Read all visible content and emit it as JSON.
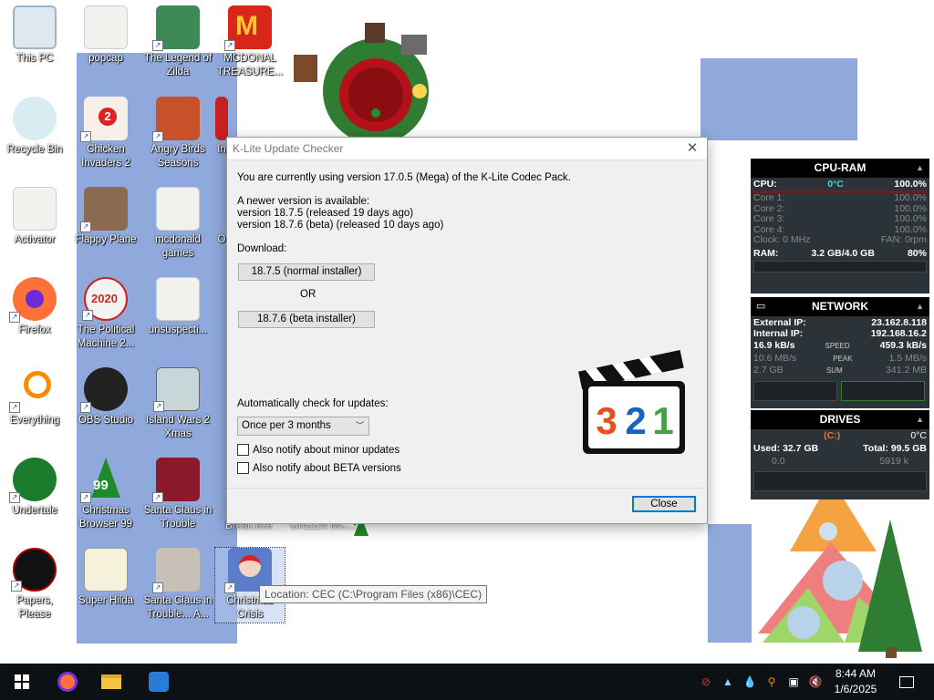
{
  "desktop": {
    "icons": [
      {
        "label": "This PC"
      },
      {
        "label": "popcap"
      },
      {
        "label": "The Legend of Zilda"
      },
      {
        "label": "MCDONAL TREASURE..."
      },
      {
        "label": "Recycle Bin"
      },
      {
        "label": "Chicken Invaders 2"
      },
      {
        "label": "Angry Birds Seasons"
      },
      {
        "label": "In"
      },
      {
        "label": "Activator"
      },
      {
        "label": "Flappy Plane"
      },
      {
        "label": "mcdonald games"
      },
      {
        "label": "O"
      },
      {
        "label": "Firefox"
      },
      {
        "label": "The Political Machine 2..."
      },
      {
        "label": "unsuspecti..."
      },
      {
        "label": "Everything"
      },
      {
        "label": "OBS Studio"
      },
      {
        "label": "Island Wars 2 Xmas"
      },
      {
        "label": "Undertale"
      },
      {
        "label": "Christmas Browser 99"
      },
      {
        "label": "Santa Claus in Trouble"
      },
      {
        "label": "Papers, Please"
      },
      {
        "label": "Super Hilda"
      },
      {
        "label": "Santa Claus in Trouble... A..."
      },
      {
        "label": "Christmas Crisis"
      },
      {
        "label": "Break.exe"
      },
      {
        "label": "GREEN MC..."
      }
    ],
    "tooltip": "Location: CEC (C:\\Program Files (x86)\\CEC)"
  },
  "dialog": {
    "title": "K-Lite Update Checker",
    "current_version": "You are currently using version 17.0.5 (Mega) of the K-Lite Codec Pack.",
    "newer_available": "A newer version is available:",
    "version_normal": "version 18.7.5  (released 19 days ago)",
    "version_beta": "version 18.7.6  (beta)  (released 10 days ago)",
    "download_label": "Download:",
    "normal_installer_button": "18.7.5 (normal installer)",
    "or_label": "OR",
    "beta_installer_button": "18.7.6 (beta installer)",
    "auto_check_label": "Automatically check for updates:",
    "auto_check_value": "Once per 3 months",
    "notify_minor": "Also notify about minor updates",
    "notify_beta": "Also notify about BETA versions",
    "close_button": "Close",
    "logo_digits": [
      "3",
      "2",
      "1"
    ]
  },
  "cpu_ram": {
    "title": "CPU-RAM",
    "cpu_label": "CPU:",
    "cpu_temp": "0°C",
    "cpu_value": "100.0%",
    "cores": [
      {
        "label": "Core 1:",
        "value": "100.0%"
      },
      {
        "label": "Core 2:",
        "value": "100.0%"
      },
      {
        "label": "Core 3:",
        "value": "100.0%"
      },
      {
        "label": "Core 4:",
        "value": "100.0%"
      }
    ],
    "clock_label": "Clock: 0 MHz",
    "fan_label": "FAN: 0rpm",
    "ram_label": "RAM:",
    "ram_value": "3.2 GB/4.0 GB",
    "ram_percent": "80%"
  },
  "network": {
    "title": "NETWORK",
    "external_ip_label": "External IP:",
    "external_ip": "23.162.8.118",
    "internal_ip_label": "Internal IP:",
    "internal_ip": "192.168.16.2",
    "down_speed": "16.9 kB/s",
    "speed_label": "SPEED",
    "up_speed": "459.3 kB/s",
    "down_peak": "10.6 MB/s",
    "peak_label": "PEAK",
    "up_peak": "1.5 MB/s",
    "down_sum": "2.7 GB",
    "sum_label": "SUM",
    "up_sum": "341.2 MB"
  },
  "drives": {
    "title": "DRIVES",
    "drive_letter": "(C:)",
    "temp": "0°C",
    "used": "Used: 32.7 GB",
    "total": "Total: 99.5 GB",
    "read": "0.0",
    "write": "5919 k"
  },
  "taskbar": {
    "time": "8:44 AM",
    "date": "1/6/2025"
  },
  "colors": {
    "wallpaper_block": "#8fa9dc",
    "taskbar": "#0c1116",
    "accent": "#0078d7",
    "gadget_bg": "#2b3338"
  }
}
